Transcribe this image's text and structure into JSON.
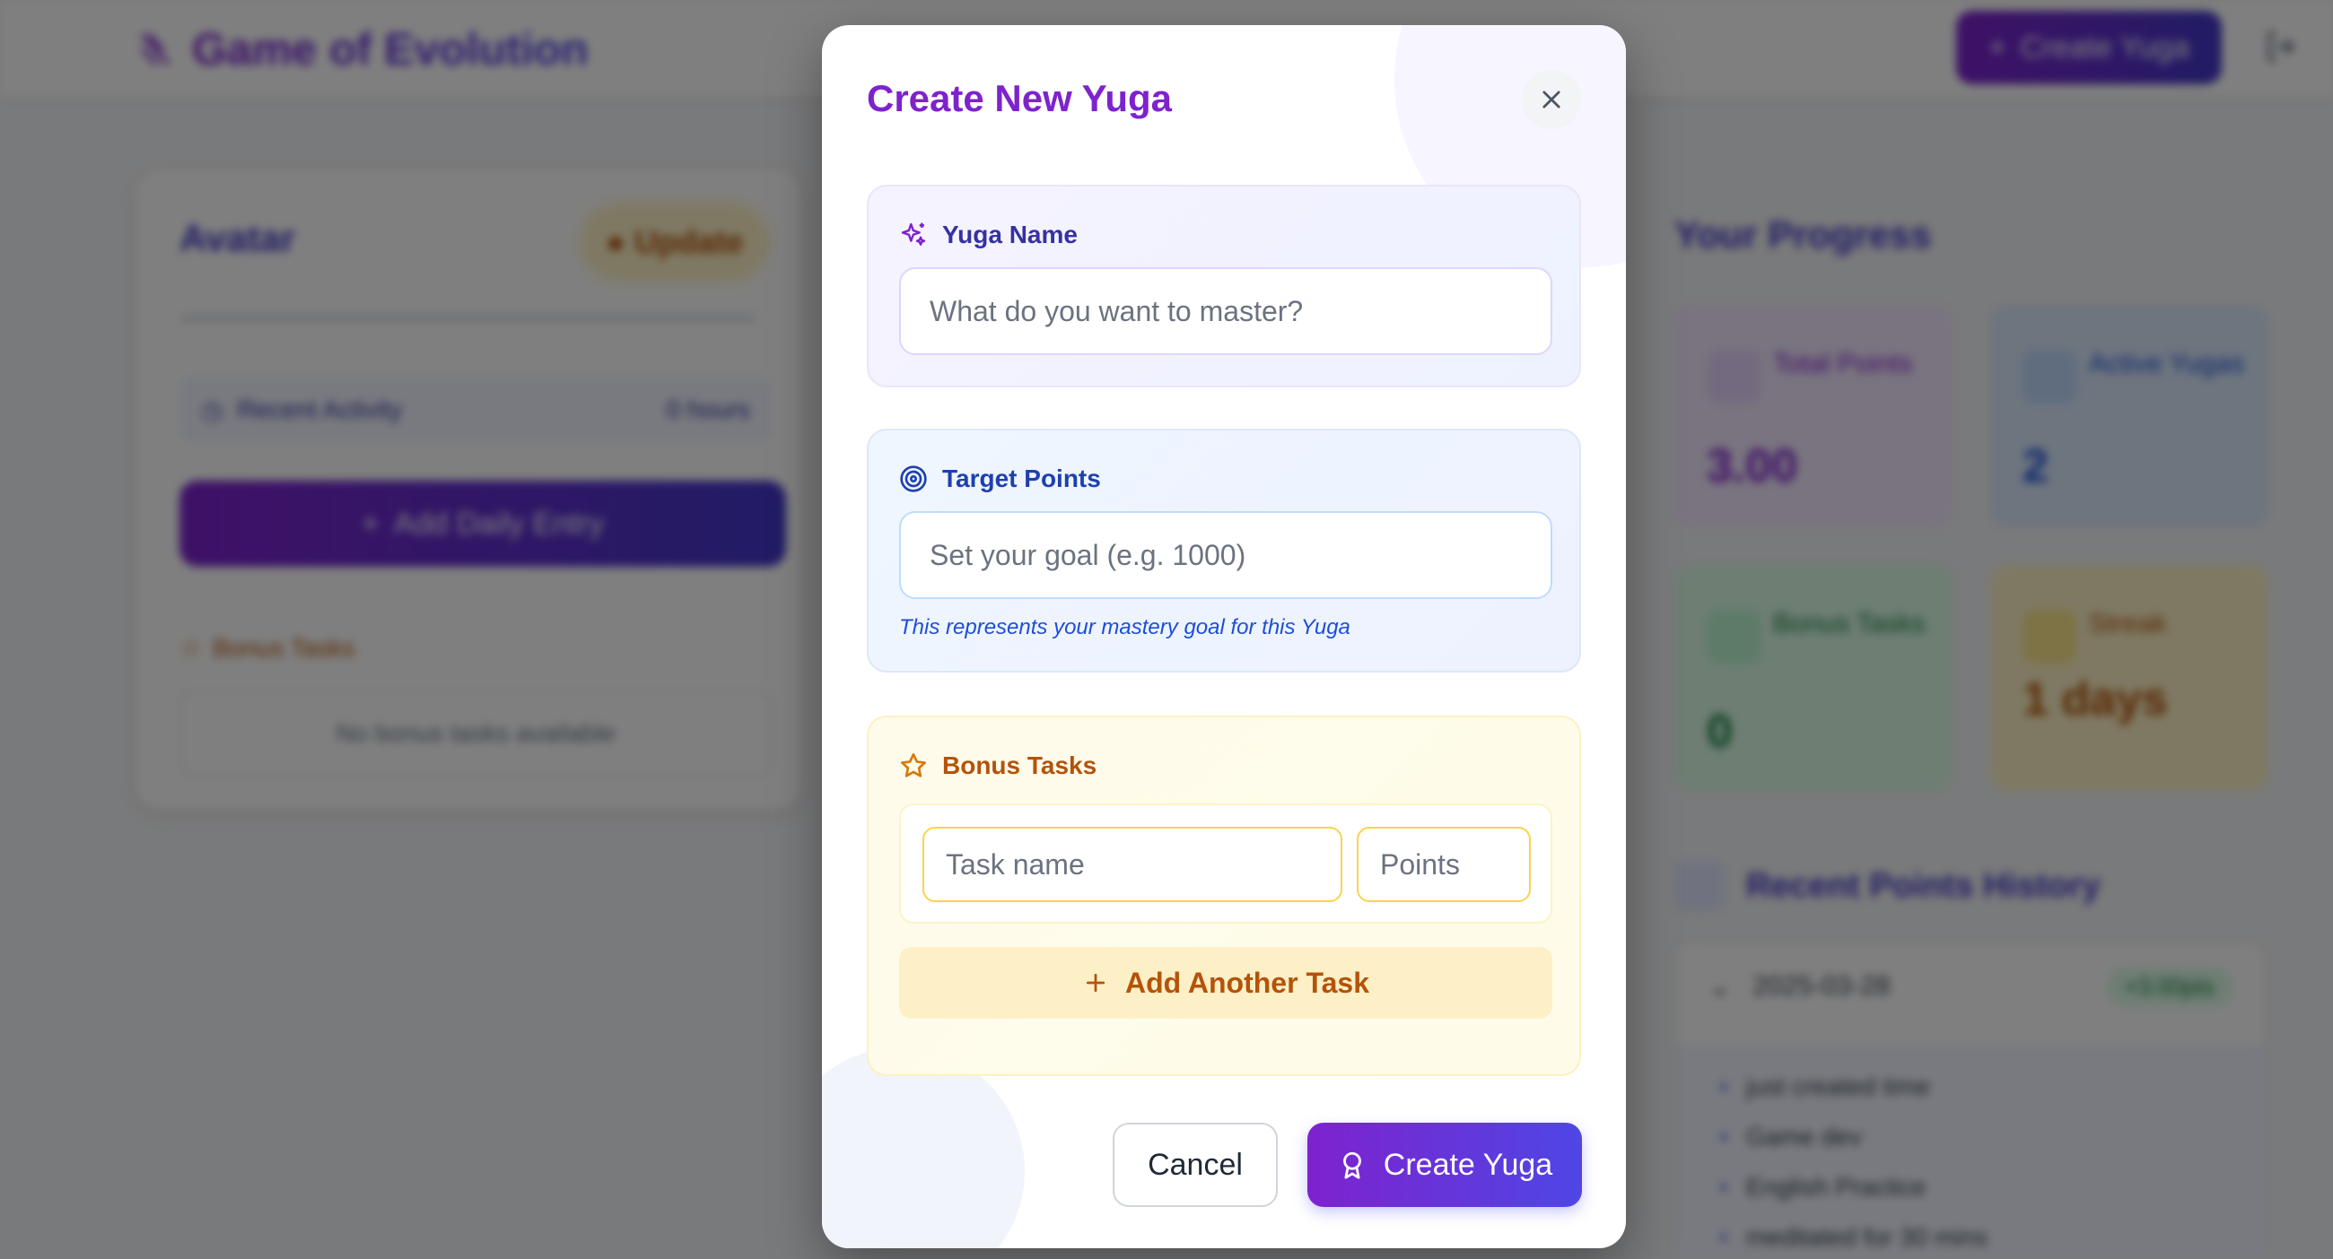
{
  "app": {
    "title": "Game of Evolution",
    "create_yuga_label": "Create Yuga"
  },
  "avatar_card": {
    "title": "Avatar",
    "update_label": "Update",
    "recent_activity_label": "Recent Activity",
    "recent_activity_time": "0 hours",
    "add_daily_entry_label": "Add Daily Entry",
    "bonus_tasks_label": "Bonus Tasks",
    "no_bonus_text": "No bonus tasks available"
  },
  "progress": {
    "title": "Your Progress",
    "stats": [
      {
        "label": "Total Points",
        "value": "3.00"
      },
      {
        "label": "Active Yugas",
        "value": "2"
      },
      {
        "label": "Bonus Tasks",
        "value": "0"
      },
      {
        "label": "Streak",
        "value": "1 days"
      }
    ],
    "history_title": "Recent Points History",
    "history_date": "2025-03-28",
    "history_badge": "+3.00pts",
    "history_items": [
      "just created time",
      "Game dev",
      "English Practice",
      "meditated for 30 mins"
    ]
  },
  "modal": {
    "title": "Create New Yuga",
    "yuga_name": {
      "label": "Yuga Name",
      "placeholder": "What do you want to master?",
      "value": ""
    },
    "target_points": {
      "label": "Target Points",
      "placeholder": "Set your goal (e.g. 1000)",
      "value": "",
      "hint": "This represents your mastery goal for this Yuga"
    },
    "bonus_tasks": {
      "label": "Bonus Tasks",
      "task_name_placeholder": "Task name",
      "points_placeholder": "Points",
      "add_task_label": "Add Another Task"
    },
    "cancel_label": "Cancel",
    "create_label": "Create Yuga"
  },
  "colors": {
    "accent_purple": "#7e22ce",
    "accent_indigo": "#4f46e5",
    "amber": "#b45309",
    "blue": "#1d4ed8"
  }
}
